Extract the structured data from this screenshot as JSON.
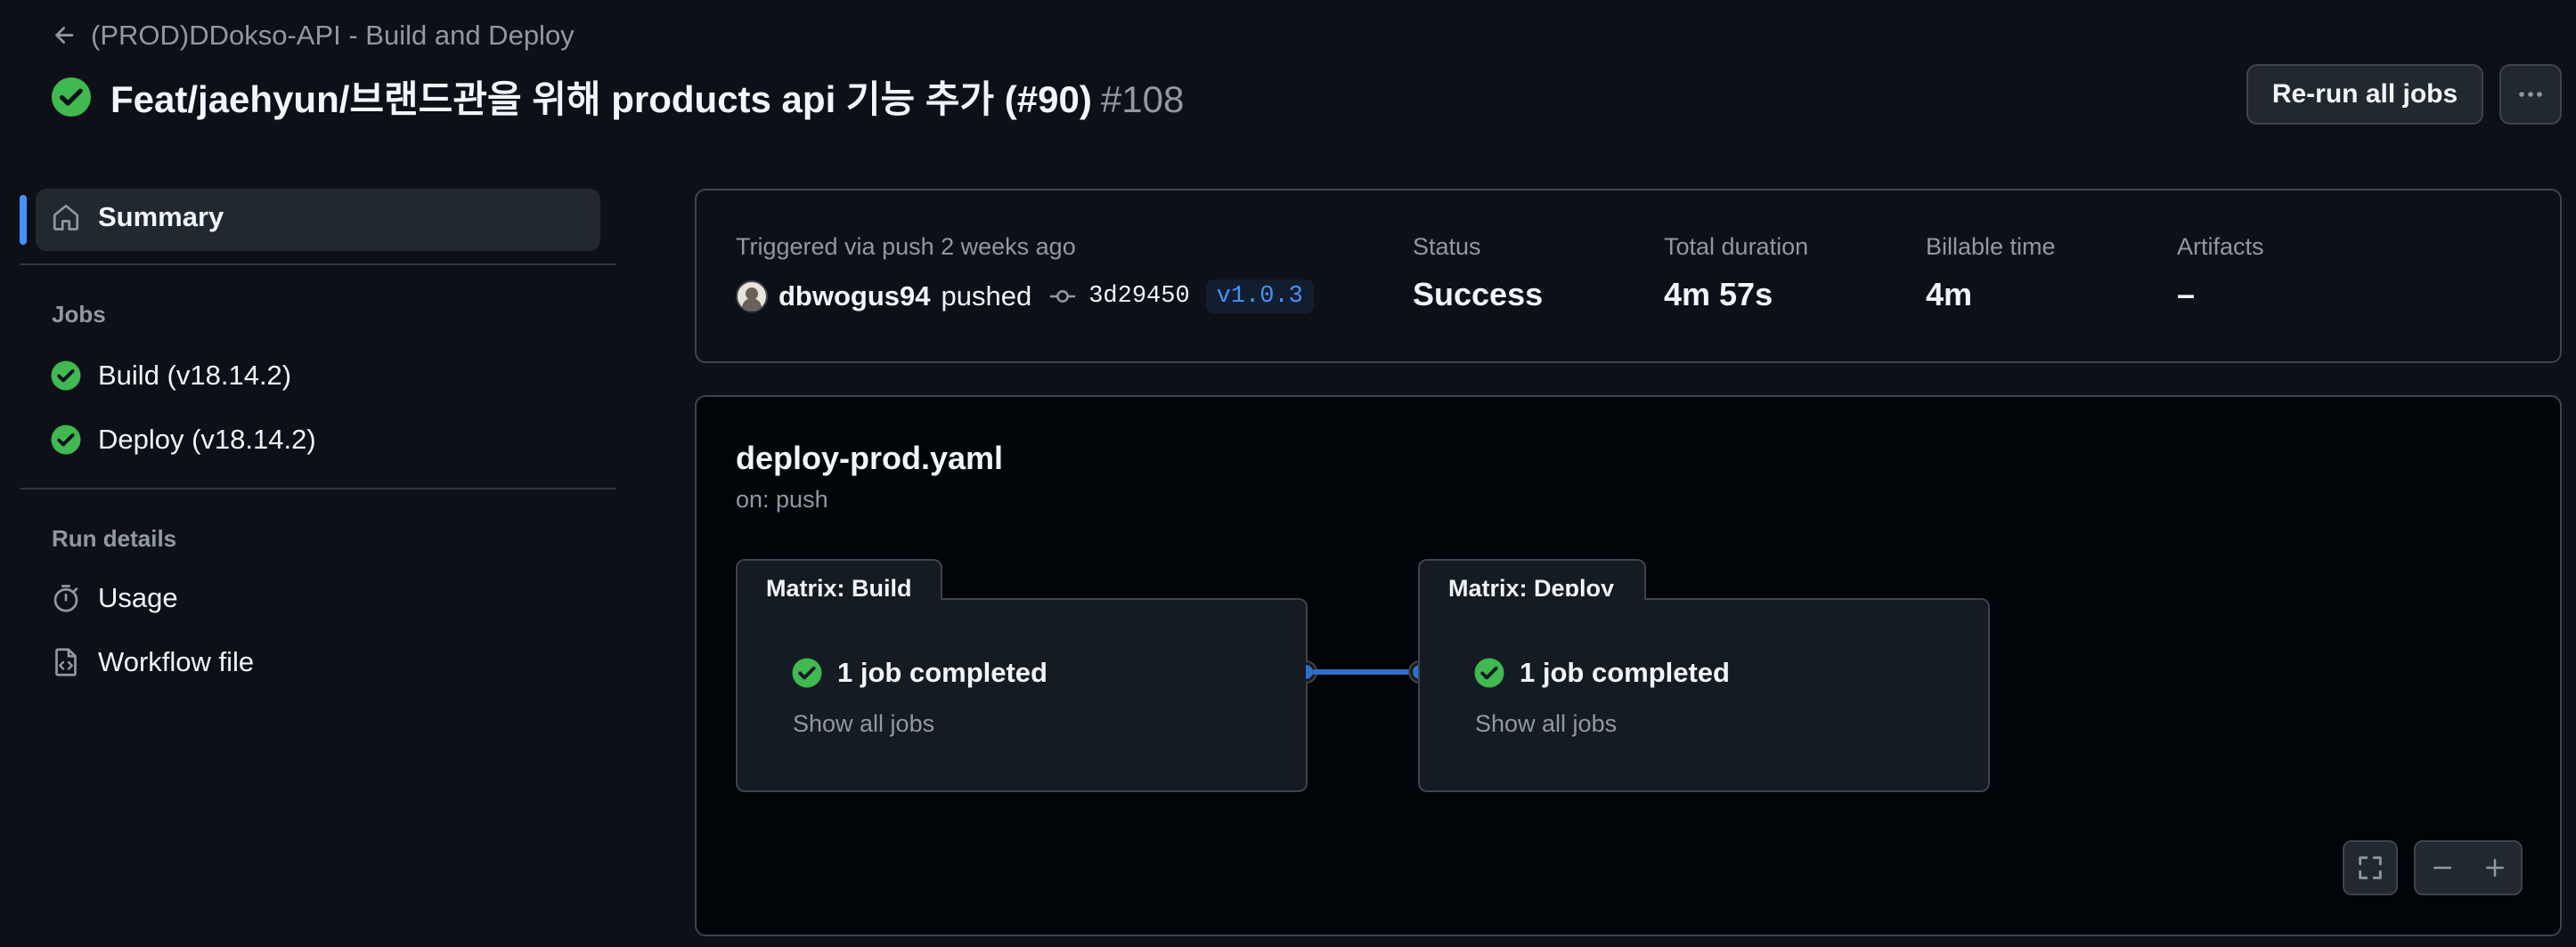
{
  "header": {
    "workflow_link": "(PROD)DDokso-API - Build and Deploy",
    "title": "Feat/jaehyun/브랜드관을 위해 products api 기능 추가 (#90)",
    "run_number": "#108",
    "rerun_label": "Re-run all jobs"
  },
  "sidebar": {
    "summary_label": "Summary",
    "jobs_heading": "Jobs",
    "jobs": [
      {
        "label": "Build (v18.14.2)"
      },
      {
        "label": "Deploy (v18.14.2)"
      }
    ],
    "run_details_heading": "Run details",
    "run_details": [
      {
        "label": "Usage",
        "icon": "stopwatch-icon"
      },
      {
        "label": "Workflow file",
        "icon": "file-code-icon"
      }
    ]
  },
  "summary": {
    "trigger_text": "Triggered via push 2 weeks ago",
    "actor": "dbwogus94",
    "action": "pushed",
    "commit_sha": "3d29450",
    "tag": "v1.0.3",
    "status_label": "Status",
    "status_value": "Success",
    "duration_label": "Total duration",
    "duration_value": "4m 57s",
    "billable_label": "Billable time",
    "billable_value": "4m",
    "artifacts_label": "Artifacts",
    "artifacts_value": "–"
  },
  "graph": {
    "workflow_file": "deploy-prod.yaml",
    "trigger": "on: push",
    "groups": [
      {
        "tab": "Matrix: Build",
        "status": "1 job completed",
        "show_all": "Show all jobs"
      },
      {
        "tab": "Matrix: Deploy",
        "status": "1 job completed",
        "show_all": "Show all jobs"
      }
    ]
  },
  "colors": {
    "success": "#3fb950",
    "accent": "#4493f8",
    "connector": "#316dca",
    "background": "#0d1117"
  }
}
